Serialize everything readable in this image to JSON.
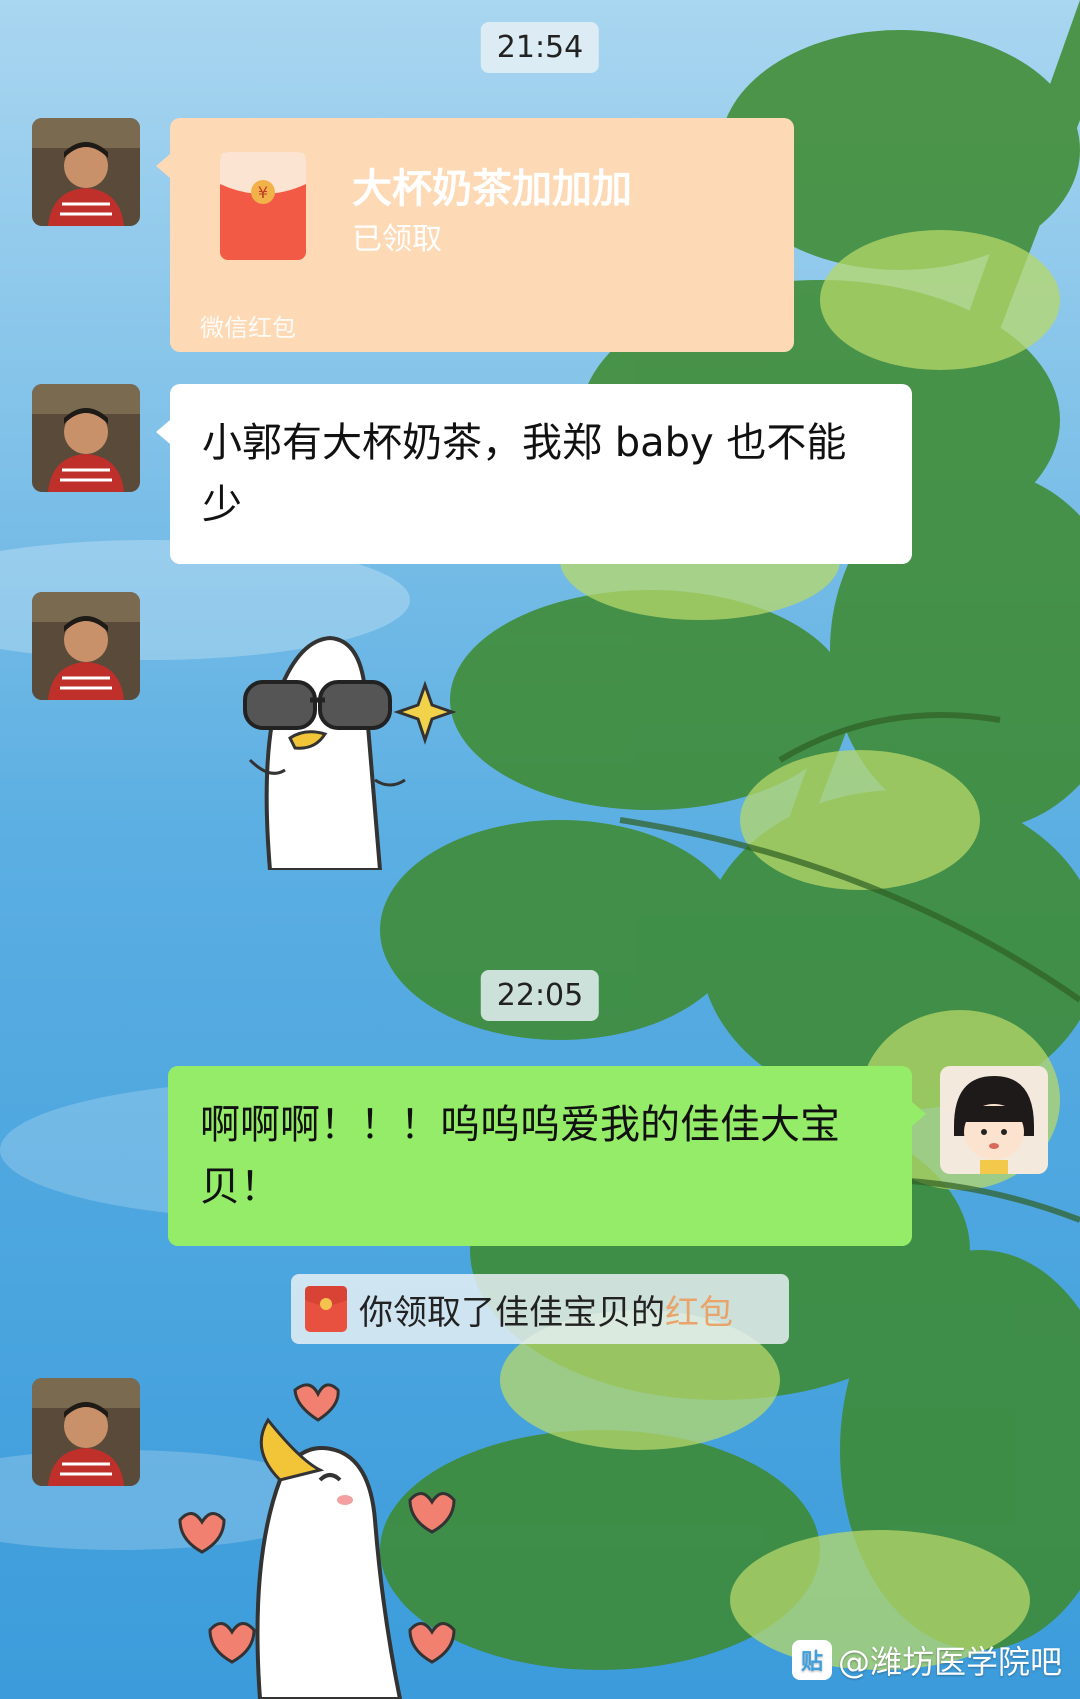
{
  "timestamps": [
    "21:54",
    "22:05"
  ],
  "red_packet": {
    "title": "大杯奶茶加加加",
    "status": "已领取",
    "footer": "微信红包"
  },
  "messages": {
    "msg1": "小郭有大杯奶茶，我郑 baby 也不能少",
    "msg2": "啊啊啊！！！呜呜呜爱我的佳佳大宝贝！"
  },
  "system_notice": {
    "prefix": "你领取了佳佳宝贝的",
    "highlight": "红包"
  },
  "watermark": {
    "logo": "贴",
    "text": "@潍坊医学院吧"
  },
  "colors": {
    "received_bubble": "#ffffff",
    "sent_bubble": "#95ec69",
    "red_packet": "#fddab5",
    "highlight": "#e8a46a"
  }
}
